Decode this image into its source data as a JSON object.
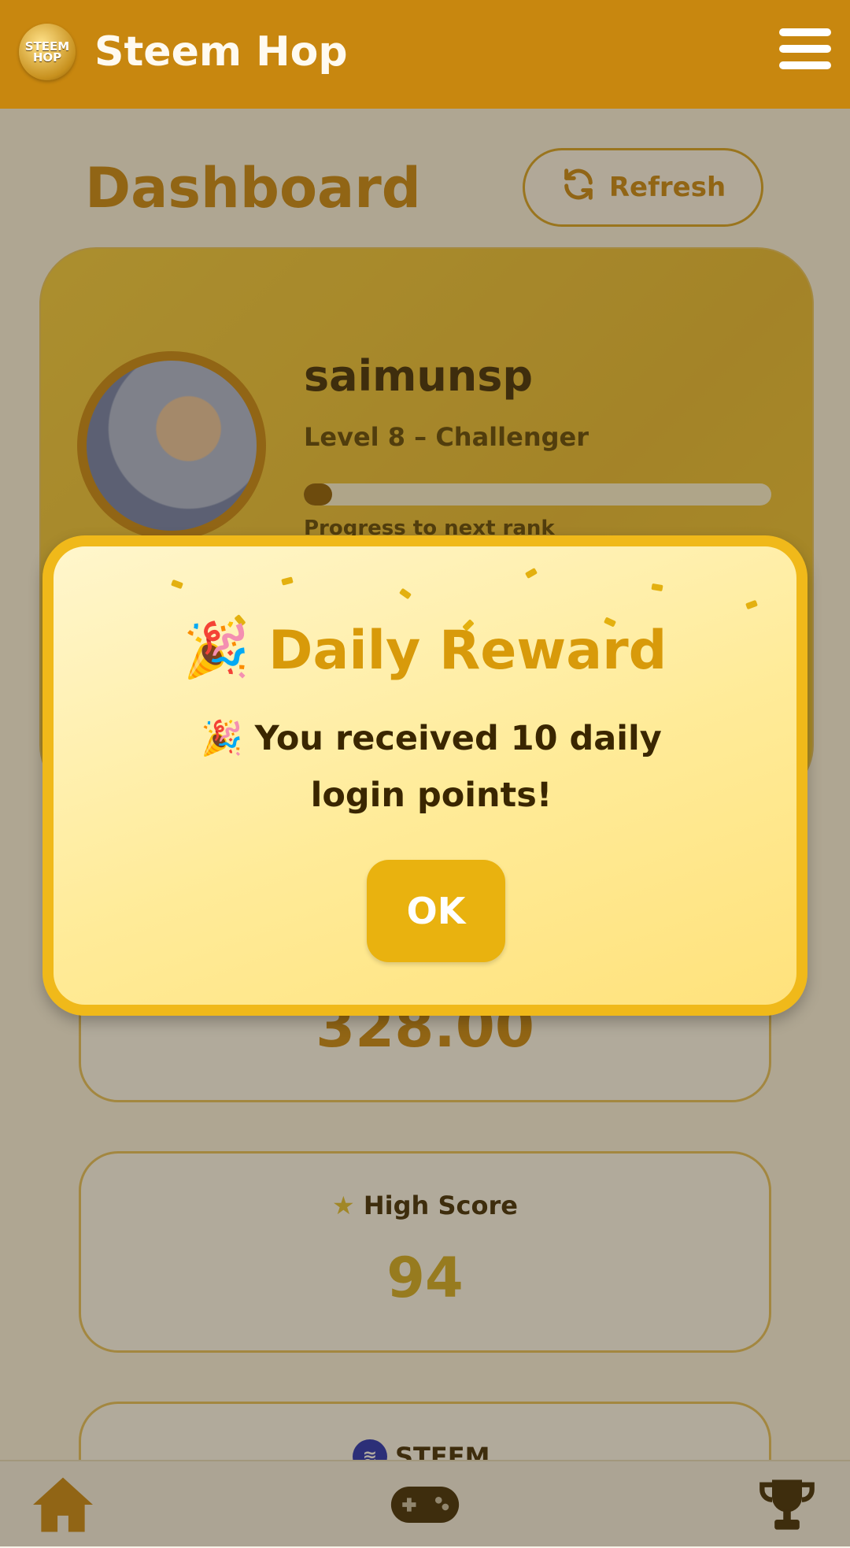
{
  "header": {
    "app_title": "Steem Hop",
    "logo_text": "STEEM HOP",
    "menu_icon": "hamburger-icon"
  },
  "dashboard": {
    "title": "Dashboard",
    "refresh_label": "Refresh",
    "refresh_icon": "refresh-icon"
  },
  "profile": {
    "username": "saimunsp",
    "level": "Level 8 – Challenger",
    "progress_label": "Progress to next rank",
    "progress_fraction": 0.06
  },
  "stats": {
    "points_value": "328.00",
    "high_score_label": "High Score",
    "high_score_value": "94",
    "steem_label": "STEEM",
    "star_icon": "star-icon"
  },
  "modal": {
    "title_emoji": "🎉",
    "title": "Daily Reward",
    "message": "🎉 You received 10 daily login points!",
    "ok_label": "OK"
  },
  "bottom_nav": [
    {
      "icon": "home-icon"
    },
    {
      "icon": "gamepad-icon"
    },
    {
      "icon": "trophy-icon"
    }
  ],
  "colors": {
    "brand": "#c8870f",
    "accent": "#f0b91a",
    "text_dark": "#3a2600"
  }
}
